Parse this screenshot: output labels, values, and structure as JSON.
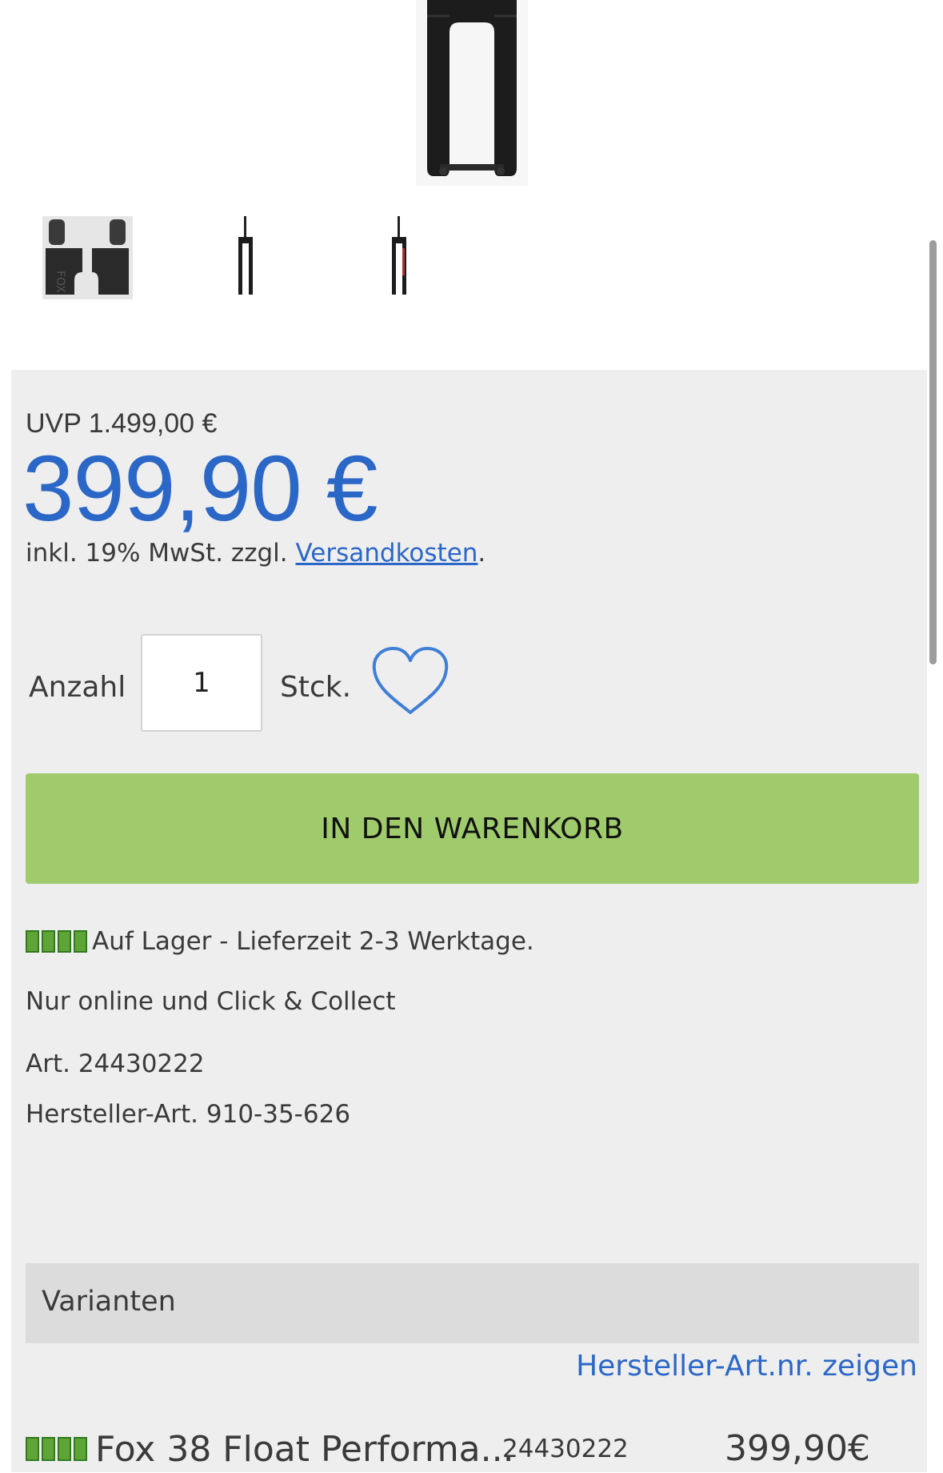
{
  "gallery": {
    "main_image": "suspension-fork-image",
    "thumbnails": [
      "fox-decal-set-thumbnail",
      "fork-black-thumbnail",
      "fork-red-accent-thumbnail"
    ]
  },
  "pricing": {
    "uvp": "UVP 1.499,00 €",
    "price": "399,90 €",
    "tax_prefix": "inkl. 19% MwSt. zzgl. ",
    "shipping_link": "Versandkosten",
    "tax_suffix": "."
  },
  "quantity": {
    "label": "Anzahl",
    "value": "1",
    "unit": "Stck.",
    "wishlist_icon": "heart-icon"
  },
  "cart": {
    "button_label": "IN DEN WARENKORB"
  },
  "availability": {
    "stock_text": "Auf Lager - Lieferzeit 2-3 Werktage.",
    "stock_level": 4,
    "stock_level_max": 4,
    "channel_text": "Nur online und Click & Collect",
    "article": "Art. 24430222",
    "manufacturer_article": "Hersteller-Art. 910-35-626"
  },
  "variants": {
    "title": "Varianten",
    "manufacturer_link": "Hersteller-Art.nr. zeigen",
    "items": [
      {
        "name": "Fox 38 Float Performa...",
        "article": "24430222",
        "price": "399,90€",
        "stock_level": 4
      }
    ]
  },
  "colors": {
    "price_blue": "#2b67c7",
    "cart_green": "#a0cb6d",
    "stock_green": "#5fa535",
    "panel_gray": "#eeeeee"
  }
}
